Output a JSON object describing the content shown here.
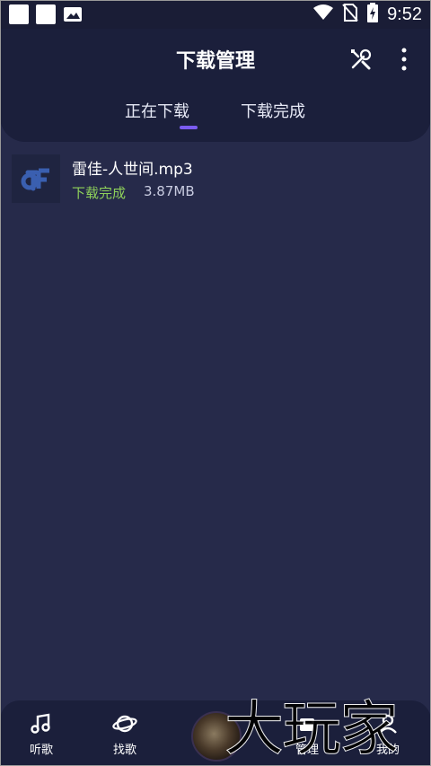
{
  "status_bar": {
    "time": "9:52",
    "icons": [
      "notification-square-icon",
      "notification-square-icon",
      "image-icon",
      "wifi-icon",
      "no-sim-icon",
      "battery-charging-icon"
    ]
  },
  "header": {
    "title": "下载管理",
    "tools_icon": "tools-icon",
    "more_icon": "more-vertical-icon",
    "tabs": [
      {
        "label": "正在下载",
        "active": true
      },
      {
        "label": "下载完成",
        "active": false
      }
    ],
    "accent_color": "#7b5cf0"
  },
  "downloads": [
    {
      "filename": "雷佳-人世间.mp3",
      "status": "下载完成",
      "size": "3.87MB",
      "thumbnail_icon": "app-logo-icon"
    }
  ],
  "bottom_nav": {
    "items": [
      {
        "label": "听歌",
        "icon": "music-note-icon"
      },
      {
        "label": "找歌",
        "icon": "planet-icon"
      },
      {
        "label": "",
        "icon": "album-disc-icon"
      },
      {
        "label": "管理",
        "icon": "manage-icon"
      },
      {
        "label": "我的",
        "icon": "profile-icon"
      }
    ]
  },
  "watermark": "大玩家",
  "colors": {
    "background": "#262a4a",
    "header_bg": "#1b1f3b",
    "status_green": "#8ed05a"
  }
}
